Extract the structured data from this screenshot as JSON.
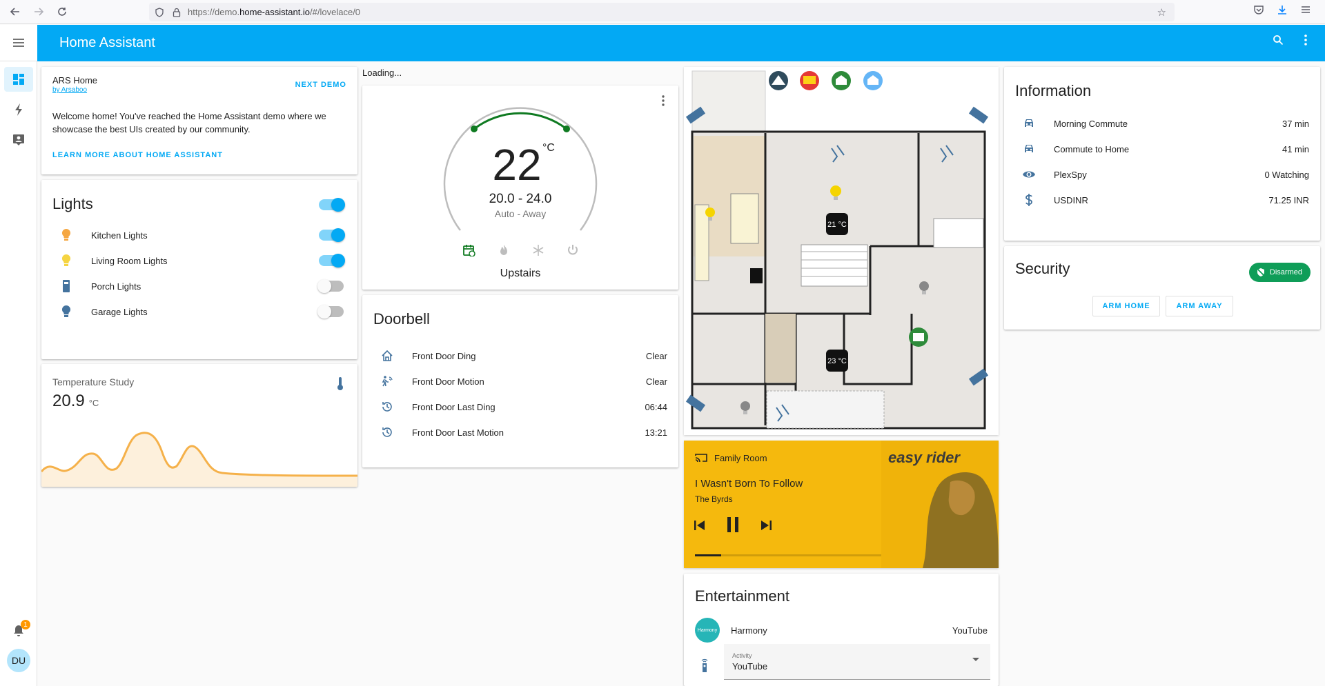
{
  "browser": {
    "url_prefix": "https://demo.",
    "url_domain": "home-assistant.io",
    "url_path": "/#/lovelace/0"
  },
  "header": {
    "title": "Home Assistant"
  },
  "sidebar": {
    "items": [
      {
        "icon": "dashboard-icon"
      },
      {
        "icon": "energy-icon"
      },
      {
        "icon": "developer-tools-icon"
      }
    ],
    "notification_count": "1",
    "user_initials": "DU"
  },
  "demo_card": {
    "title": "ARS Home",
    "author": "by Arsaboo",
    "next_demo": "NEXT DEMO",
    "text": "Welcome home! You've reached the Home Assistant demo where we showcase the best UIs created by our community.",
    "learn_more": "LEARN MORE ABOUT HOME ASSISTANT"
  },
  "lights": {
    "title": "Lights",
    "master_on": true,
    "items": [
      {
        "label": "Kitchen Lights",
        "on": true,
        "color": "#f5a742"
      },
      {
        "label": "Living Room Lights",
        "on": true,
        "color": "#f5d442"
      },
      {
        "label": "Porch Lights",
        "on": false,
        "color": "#44739e"
      },
      {
        "label": "Garage Lights",
        "on": false,
        "color": "#44739e"
      }
    ]
  },
  "temperature": {
    "name": "Temperature Study",
    "value": "20.9",
    "unit": "°C"
  },
  "loading_text": "Loading...",
  "thermostat": {
    "current": "22",
    "unit": "°C",
    "range": "20.0 - 24.0",
    "mode": "Auto - Away",
    "name": "Upstairs"
  },
  "doorbell": {
    "title": "Doorbell",
    "rows": [
      {
        "label": "Front Door Ding",
        "value": "Clear",
        "icon": "home-outline-icon"
      },
      {
        "label": "Front Door Motion",
        "value": "Clear",
        "icon": "motion-sensor-icon"
      },
      {
        "label": "Front Door Last Ding",
        "value": "06:44",
        "icon": "history-icon"
      },
      {
        "label": "Front Door Last Motion",
        "value": "13:21",
        "icon": "history-icon"
      }
    ]
  },
  "floorplan": {
    "temp_upstairs": "21 °C",
    "temp_downstairs": "23 °C"
  },
  "media": {
    "room": "Family Room",
    "song": "I Wasn't Born To Follow",
    "artist": "The Byrds",
    "progress_fraction": 0.09,
    "album_text": "easy rider"
  },
  "entertainment": {
    "title": "Entertainment",
    "device": "Harmony",
    "device_value": "YouTube",
    "avatar_text": "Harmony",
    "activity_label": "Activity",
    "activity_value": "YouTube"
  },
  "information": {
    "title": "Information",
    "rows": [
      {
        "label": "Morning Commute",
        "value": "37 min",
        "icon": "car-icon"
      },
      {
        "label": "Commute to Home",
        "value": "41 min",
        "icon": "car-icon"
      },
      {
        "label": "PlexSpy",
        "value": "0 Watching",
        "icon": "eye-icon"
      },
      {
        "label": "USDINR",
        "value": "71.25 INR",
        "icon": "currency-usd-icon"
      }
    ]
  },
  "security": {
    "title": "Security",
    "state": "Disarmed",
    "arm_home": "ARM HOME",
    "arm_away": "ARM AWAY"
  },
  "colors": {
    "primary": "#03a9f4",
    "media_bg": "#f5b90d",
    "disarmed": "#0f9d58",
    "graph": "#f5b14a"
  }
}
